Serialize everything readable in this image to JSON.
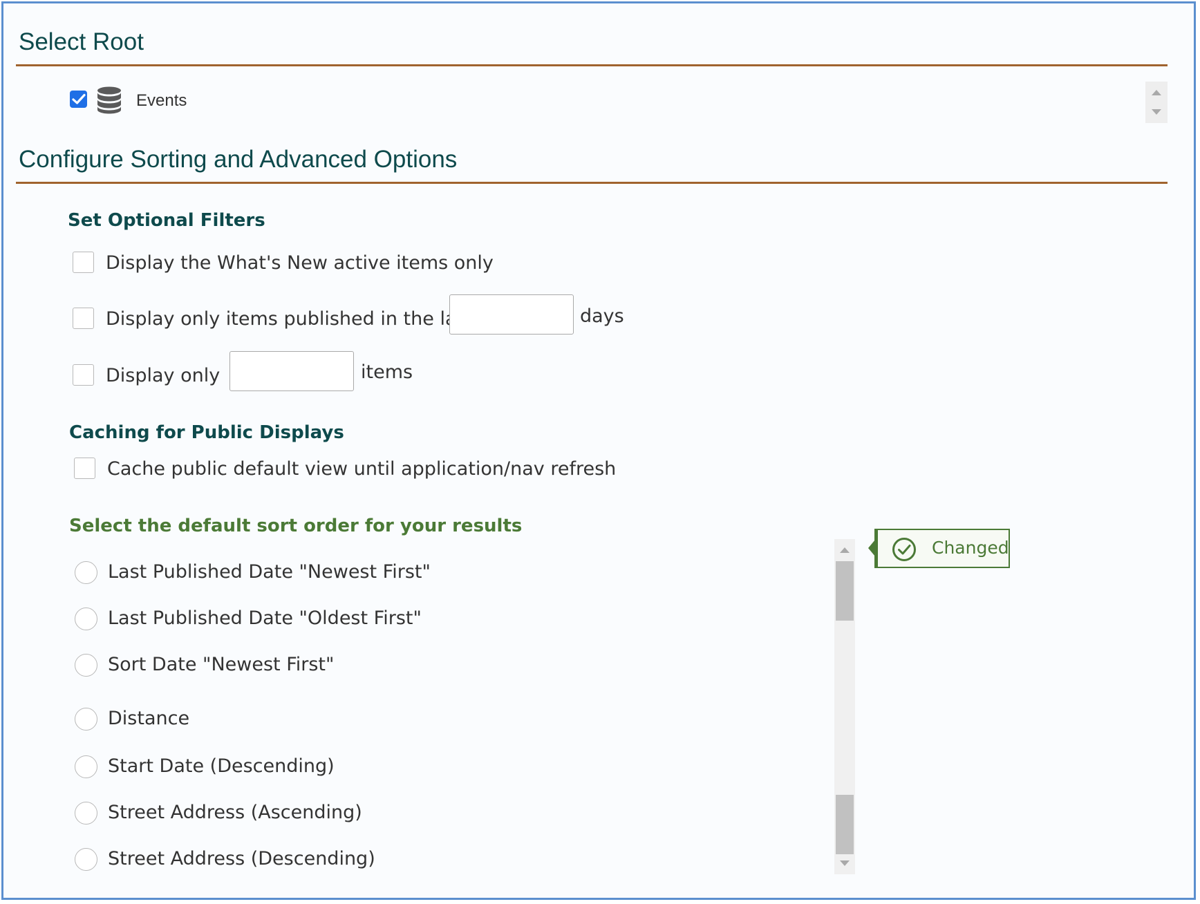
{
  "select_root": {
    "title": "Select Root",
    "items": [
      {
        "label": "Events",
        "checked": true,
        "icon": "database-icon"
      }
    ]
  },
  "configure": {
    "title": "Configure Sorting and Advanced Options"
  },
  "filters": {
    "heading": "Set Optional Filters",
    "whats_new_label": "Display the What's New active items only",
    "published_label": "Display only items published in the last",
    "published_days_value": "",
    "published_suffix": "days",
    "display_only_label": "Display only",
    "display_only_value": "",
    "display_only_suffix": "items"
  },
  "caching": {
    "heading": "Caching for Public Displays",
    "cache_label": "Cache public default view until application/nav refresh"
  },
  "sort": {
    "heading": "Select the default sort order for your results",
    "options": [
      "Last Published Date \"Newest First\"",
      "Last Published Date \"Oldest First\"",
      "Sort Date \"Newest First\"",
      "Distance",
      "Start Date (Descending)",
      "Street Address (Ascending)",
      "Street Address (Descending)"
    ]
  },
  "status": {
    "changed_label": "Changed",
    "icon": "check-circle-icon"
  },
  "colors": {
    "heading_teal": "#0e4a4c",
    "rule_brown": "#a0632e",
    "accent_green": "#4b7a36",
    "checkbox_blue": "#1f6fe6",
    "frame_blue": "#5b8fcf"
  }
}
